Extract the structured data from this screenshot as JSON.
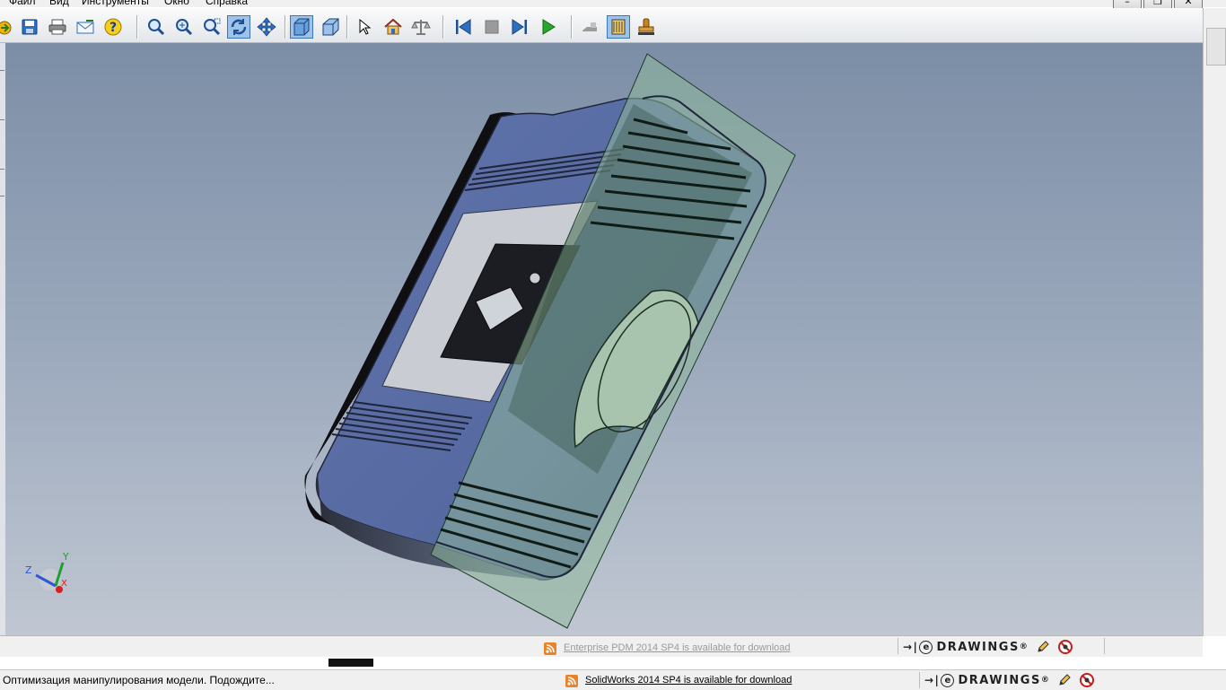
{
  "menu": [
    "Файл",
    "Вид",
    "Инструменты",
    "Окно",
    "Справка"
  ],
  "window_controls": [
    "–",
    "❐",
    "✕"
  ],
  "toolbar": {
    "buttons": [
      {
        "name": "open-icon",
        "active": false
      },
      {
        "name": "save-icon",
        "active": false
      },
      {
        "name": "print-icon",
        "active": false
      },
      {
        "name": "email-icon",
        "active": false
      },
      {
        "name": "help-icon",
        "active": false
      },
      {
        "name": "zoom-icon",
        "active": false
      },
      {
        "name": "zoom-in-out-icon",
        "active": false
      },
      {
        "name": "zoom-area-icon",
        "active": false
      },
      {
        "name": "rotate-icon",
        "active": true
      },
      {
        "name": "pan-icon",
        "active": false
      },
      {
        "name": "shaded-view-icon",
        "active": true
      },
      {
        "name": "perspective-view-icon",
        "active": false
      },
      {
        "name": "select-arrow-icon",
        "active": false
      },
      {
        "name": "home-view-icon",
        "active": false
      },
      {
        "name": "measure-scale-icon",
        "active": false
      },
      {
        "name": "first-frame-icon",
        "active": false
      },
      {
        "name": "stop-icon",
        "active": false
      },
      {
        "name": "next-frame-icon",
        "active": false
      },
      {
        "name": "play-icon",
        "active": false
      },
      {
        "name": "hide-show-icon",
        "active": false
      },
      {
        "name": "section-view-icon",
        "active": true
      },
      {
        "name": "stamp-icon",
        "active": false
      }
    ]
  },
  "news": {
    "enterprise": "Enterprise PDM 2014 SP4 is available for download",
    "solidworks": "SolidWorks 2014 SP4 is available for download"
  },
  "brand": {
    "label": "DRAWINGS",
    "registered": "®",
    "e_letter": "e"
  },
  "status": {
    "message": "Оптимизация манипулирования модели. Подождите..."
  },
  "triad": {
    "x": "X",
    "y": "Y",
    "z": "Z"
  },
  "colors": {
    "part_blue": "#5b6ea3",
    "section_plane": "#8fb89b",
    "accent": "#3f75b5"
  }
}
